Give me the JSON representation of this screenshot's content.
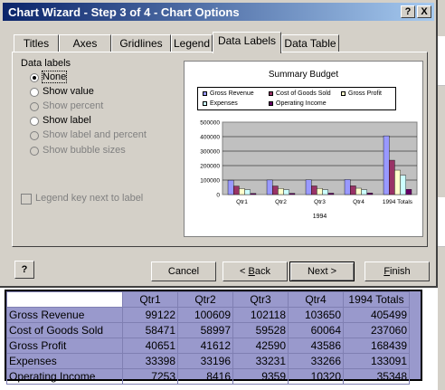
{
  "window": {
    "title": "Chart Wizard - Step 3 of 4 - Chart Options",
    "help_label": "?",
    "close_label": "X"
  },
  "tabs": [
    {
      "label": "Titles"
    },
    {
      "label": "Axes"
    },
    {
      "label": "Gridlines"
    },
    {
      "label": "Legend"
    },
    {
      "label": "Data Labels",
      "active": true
    },
    {
      "label": "Data Table"
    }
  ],
  "data_labels": {
    "group_label": "Data labels",
    "options": [
      {
        "label": "None",
        "selected": true,
        "enabled": true
      },
      {
        "label": "Show value",
        "selected": false,
        "enabled": true
      },
      {
        "label": "Show percent",
        "selected": false,
        "enabled": false
      },
      {
        "label": "Show label",
        "selected": false,
        "enabled": true
      },
      {
        "label": "Show label and percent",
        "selected": false,
        "enabled": false
      },
      {
        "label": "Show bubble sizes",
        "selected": false,
        "enabled": false
      }
    ],
    "legend_key_label": "Legend key next to label"
  },
  "chart_data": {
    "type": "bar",
    "title": "Summary Budget",
    "xlabel": "1994",
    "ylabel": "",
    "categories": [
      "Qtr1",
      "Qtr2",
      "Qtr3",
      "Qtr4",
      "1994 Totals"
    ],
    "yticks": [
      "500000",
      "400000",
      "300000",
      "200000",
      "100000",
      "0"
    ],
    "ylim": [
      0,
      500000
    ],
    "grid": true,
    "legend_placement": "top",
    "series": [
      {
        "name": "Gross Revenue",
        "color": "#9999ff",
        "values": [
          99122,
          100609,
          102118,
          103650,
          405499
        ]
      },
      {
        "name": "Cost of Goods Sold",
        "color": "#993366",
        "values": [
          58471,
          58997,
          59528,
          60064,
          237060
        ]
      },
      {
        "name": "Gross Profit",
        "color": "#ffffcc",
        "values": [
          40651,
          41612,
          42590,
          43586,
          168439
        ]
      },
      {
        "name": "Expenses",
        "color": "#ccffff",
        "values": [
          33398,
          33196,
          33231,
          33266,
          133091
        ]
      },
      {
        "name": "Operating Income",
        "color": "#660066",
        "values": [
          7253,
          8416,
          9359,
          10320,
          35348
        ]
      }
    ]
  },
  "buttons": {
    "help_icon_label": "?",
    "cancel": "Cancel",
    "back_prefix": "< ",
    "back_accel": "B",
    "back_rest": "ack",
    "next": "Next >",
    "finish_accel": "F",
    "finish_rest": "inish"
  },
  "sheet": {
    "headers": [
      "Qtr1",
      "Qtr2",
      "Qtr3",
      "Qtr4",
      "1994 Totals"
    ],
    "rows": [
      {
        "label": "Gross Revenue",
        "values": [
          "99122",
          "100609",
          "102118",
          "103650",
          "405499"
        ]
      },
      {
        "label": "Cost of Goods Sold",
        "values": [
          "58471",
          "58997",
          "59528",
          "60064",
          "237060"
        ]
      },
      {
        "label": "Gross Profit",
        "values": [
          "40651",
          "41612",
          "42590",
          "43586",
          "168439"
        ]
      },
      {
        "label": "Expenses",
        "values": [
          "33398",
          "33196",
          "33231",
          "33266",
          "133091"
        ]
      },
      {
        "label": "Operating Income",
        "values": [
          "7253",
          "8416",
          "9359",
          "10320",
          "35348"
        ]
      }
    ]
  }
}
